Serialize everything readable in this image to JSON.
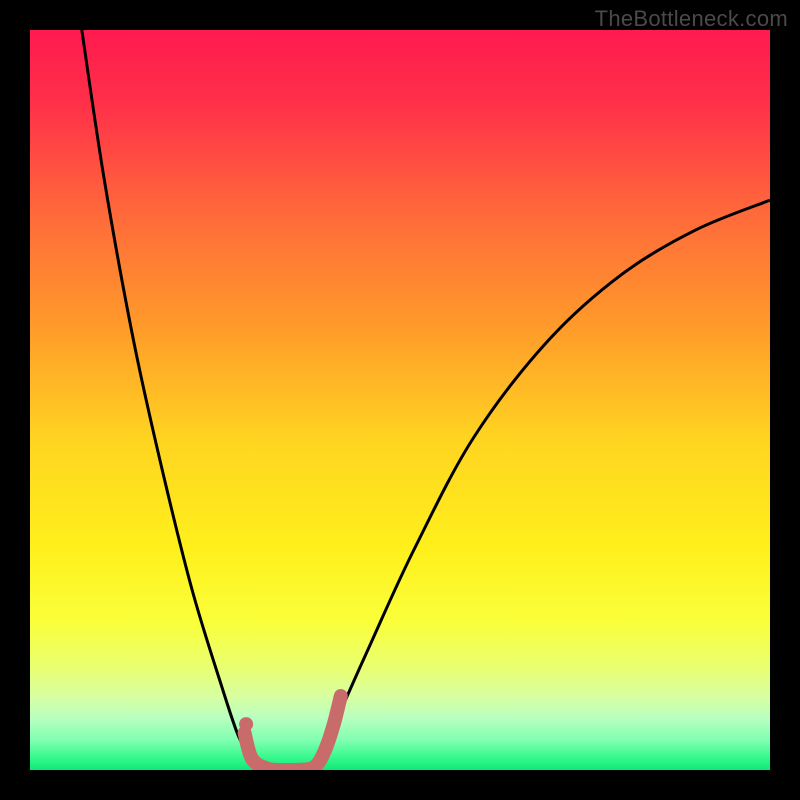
{
  "watermark": "TheBottleneck.com",
  "colors": {
    "frame_bg": "#000000",
    "gradient_stops": [
      {
        "offset": 0.0,
        "color": "#ff1a4f"
      },
      {
        "offset": 0.1,
        "color": "#ff3049"
      },
      {
        "offset": 0.25,
        "color": "#ff6a3a"
      },
      {
        "offset": 0.4,
        "color": "#ff9a2a"
      },
      {
        "offset": 0.55,
        "color": "#ffd321"
      },
      {
        "offset": 0.7,
        "color": "#fff01c"
      },
      {
        "offset": 0.8,
        "color": "#faff3a"
      },
      {
        "offset": 0.86,
        "color": "#eaff70"
      },
      {
        "offset": 0.9,
        "color": "#d8ffa0"
      },
      {
        "offset": 0.93,
        "color": "#b8ffc0"
      },
      {
        "offset": 0.96,
        "color": "#80ffb0"
      },
      {
        "offset": 0.985,
        "color": "#30f88a"
      },
      {
        "offset": 1.0,
        "color": "#10e878"
      }
    ],
    "curve_stroke": "#000000",
    "accent_stroke": "#c96b6b",
    "accent_dot": "#c96b6b"
  },
  "chart_data": {
    "type": "line",
    "title": "",
    "xlabel": "",
    "ylabel": "",
    "xlim": [
      0,
      100
    ],
    "ylim": [
      0,
      100
    ],
    "note": "Stylized V-shaped bottleneck curve; numeric series are approximate readings off the figure (x = horizontal position 0–100 left→right, y = height 0–100 bottom→top).",
    "series": [
      {
        "name": "left-branch",
        "x": [
          7,
          10,
          14,
          18,
          22,
          26,
          28,
          29.5,
          30.5
        ],
        "y": [
          100,
          80,
          58,
          40,
          24,
          11,
          5,
          2,
          0
        ]
      },
      {
        "name": "right-branch",
        "x": [
          38,
          40,
          42,
          46,
          52,
          60,
          70,
          80,
          90,
          100
        ],
        "y": [
          0,
          3,
          8,
          17,
          30,
          45,
          58,
          67,
          73,
          77
        ]
      },
      {
        "name": "accent-window",
        "x": [
          29,
          30,
          32,
          34,
          36,
          38,
          39,
          40,
          41,
          42
        ],
        "y": [
          5,
          1.5,
          0.2,
          0,
          0,
          0.2,
          1,
          3,
          6,
          10
        ]
      }
    ],
    "markers": [
      {
        "name": "accent-dot",
        "x": 29.2,
        "y": 6.2
      }
    ]
  }
}
